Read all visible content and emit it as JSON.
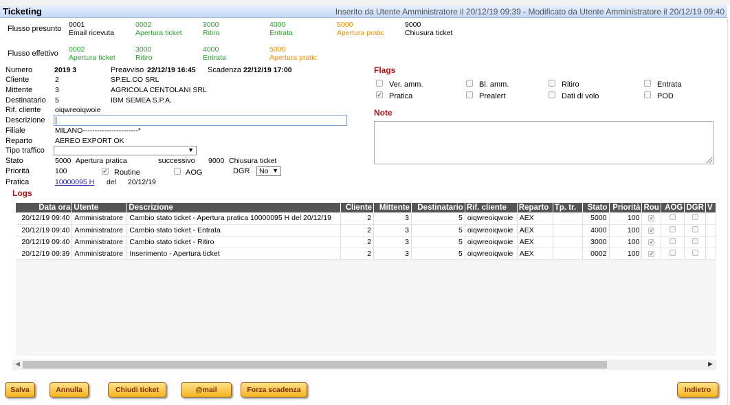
{
  "header": {
    "title": "Ticketing",
    "info": "Inserito da Utente Amministratore il 20/12/19 09:39 - Modificato da Utente Amministratore il 20/12/19 09:40"
  },
  "flusso_presunto": {
    "label": "Flusso presunto",
    "steps": [
      {
        "code": "0001",
        "name": "Email ricevuta"
      },
      {
        "code": "0002",
        "name": "Apertura ticket"
      },
      {
        "code": "3000",
        "name": "Ritiro"
      },
      {
        "code": "4000",
        "name": "Entrata"
      },
      {
        "code": "5000",
        "name": "Apertura pratic"
      },
      {
        "code": "9000",
        "name": "Chiusura ticket"
      }
    ]
  },
  "flusso_effettivo": {
    "label": "Flusso effettivo",
    "steps": [
      {
        "code": "0002",
        "name": "Apertura ticket"
      },
      {
        "code": "3000",
        "name": "Ritiro"
      },
      {
        "code": "4000",
        "name": "Entrata"
      },
      {
        "code": "5000",
        "name": "Apertura pratic"
      }
    ]
  },
  "form": {
    "numero_label": "Numero",
    "numero": "2019 3",
    "preavviso_label": "Preavviso",
    "preavviso": "22/12/19 16:45",
    "scadenza_label": "Scadenza",
    "scadenza": "22/12/19 17:00",
    "cliente_label": "Cliente",
    "cliente_code": "2",
    "cliente_name": "SP.EL.CO SRL",
    "mittente_label": "Mittente",
    "mittente_code": "3",
    "mittente_name": "AGRICOLA CENTOLANI SRL",
    "destinatario_label": "Destinatario",
    "destinatario_code": "5",
    "destinatario_name": "IBM SEMEA S.P.A.",
    "rif_label": "Rif. cliente",
    "rif": "oiqwreoiqwoie",
    "descrizione_label": "Descrizione",
    "descrizione": "",
    "filiale_label": "Filiale",
    "filiale": "MILANO-----------------------*",
    "reparto_label": "Reparto",
    "reparto": "AEREO EXPORT OK",
    "tipo_label": "Tipo traffico",
    "tipo": "",
    "stato_label": "Stato",
    "stato_code": "5000",
    "stato_name": "Apertura pratica",
    "successivo_label": "successivo",
    "successivo_code": "9000",
    "successivo_name": "Chiusura ticket",
    "priorita_label": "Priorità",
    "priorita": "100",
    "routine_label": "Routine",
    "routine_checked": true,
    "aog_label": "AOG",
    "aog_checked": false,
    "dgr_label": "DGR",
    "dgr": "No",
    "pratica_label": "Pratica",
    "pratica_link": "10000095 H",
    "del_label": "del",
    "pratica_date": "20/12/19"
  },
  "flags": {
    "title": "Flags",
    "items": [
      {
        "label": "Ver. amm.",
        "checked": false
      },
      {
        "label": "Bl. amm.",
        "checked": false
      },
      {
        "label": "Ritiro",
        "checked": false
      },
      {
        "label": "Entrata",
        "checked": false
      },
      {
        "label": "Pratica",
        "checked": true
      },
      {
        "label": "Prealert",
        "checked": false
      },
      {
        "label": "Dati di volo",
        "checked": false
      },
      {
        "label": "POD",
        "checked": false
      }
    ]
  },
  "note": {
    "title": "Note",
    "value": ""
  },
  "logs": {
    "title": "Logs",
    "columns": [
      "Data ora",
      "Utente",
      "Descrizione",
      "Cliente",
      "Mittente",
      "Destinatario",
      "Rif. cliente",
      "Reparto",
      "Tp. tr.",
      "Stato",
      "Priorità",
      "Rou",
      "AOG",
      "DGR",
      "V"
    ],
    "rows": [
      {
        "data": "20/12/19 09:40",
        "utente": "Amministratore",
        "descrizione": "Cambio stato ticket - Apertura pratica 10000095 H del 20/12/19",
        "cliente": "2",
        "mittente": "3",
        "destinatario": "5",
        "rif": "oiqwreoiqwoie",
        "reparto": "AEX",
        "tp": "",
        "stato": "5000",
        "priorita": "100",
        "rou": true,
        "aog": false,
        "dgr": false
      },
      {
        "data": "20/12/19 09:40",
        "utente": "Amministratore",
        "descrizione": "Cambio stato ticket - Entrata",
        "cliente": "2",
        "mittente": "3",
        "destinatario": "5",
        "rif": "oiqwreoiqwoie",
        "reparto": "AEX",
        "tp": "",
        "stato": "4000",
        "priorita": "100",
        "rou": true,
        "aog": false,
        "dgr": false
      },
      {
        "data": "20/12/19 09:40",
        "utente": "Amministratore",
        "descrizione": "Cambio stato ticket - Ritiro",
        "cliente": "2",
        "mittente": "3",
        "destinatario": "5",
        "rif": "oiqwreoiqwoie",
        "reparto": "AEX",
        "tp": "",
        "stato": "3000",
        "priorita": "100",
        "rou": true,
        "aog": false,
        "dgr": false
      },
      {
        "data": "20/12/19 09:39",
        "utente": "Amministratore",
        "descrizione": "Inserimento - Apertura ticket",
        "cliente": "2",
        "mittente": "3",
        "destinatario": "5",
        "rif": "oiqwreoiqwoie",
        "reparto": "AEX",
        "tp": "",
        "stato": "0002",
        "priorita": "100",
        "rou": true,
        "aog": false,
        "dgr": false
      }
    ]
  },
  "buttons": {
    "salva": "Salva",
    "annulla": "Annulla",
    "chiudi": "Chiudi ticket",
    "email": "@mail",
    "forza": "Forza scadenza",
    "indietro": "Indietro"
  },
  "icons": {
    "check": "check-mark",
    "dropdown": "triangle-down",
    "scroll_left": "triangle-left",
    "scroll_right": "triangle-right"
  }
}
